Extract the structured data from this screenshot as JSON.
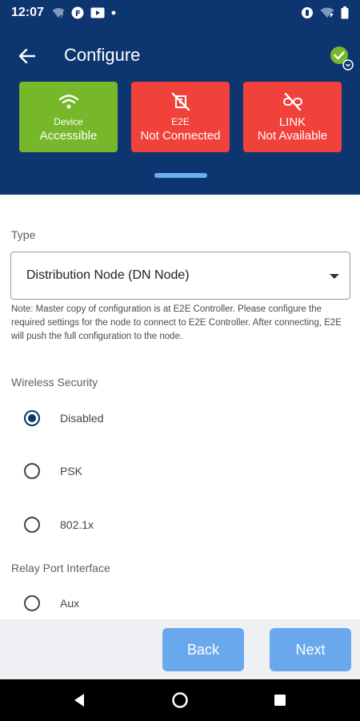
{
  "status_bar": {
    "time": "12:07",
    "left_icons": [
      "wifi-question-icon",
      "location-icon",
      "cast-icon",
      "notification-dot-icon"
    ],
    "right_icons": [
      "record-icon",
      "wifi-icon",
      "battery-icon"
    ]
  },
  "header": {
    "title": "Configure",
    "back_icon": "arrow-left-icon",
    "status_icon": "check-circle-icon"
  },
  "tiles": [
    {
      "icon": "wifi-icon",
      "line1": "Device",
      "line2": "Accessible",
      "color": "#76b82a"
    },
    {
      "icon": "cloud-off-icon",
      "line1": "E2E",
      "line2": "Not Connected",
      "color": "#f0413b"
    },
    {
      "icon": "link-off-icon",
      "line1": "LINK",
      "line2": "Not Available",
      "color": "#f0413b"
    }
  ],
  "form": {
    "type_label": "Type",
    "type_value": "Distribution Node (DN Node)",
    "note": "Note: Master copy of configuration is at E2E Controller. Please configure the required settings for the node to connect to E2E Controller. After connecting, E2E will push the full configuration to the node.",
    "wireless_label": "Wireless Security",
    "wireless_options": [
      {
        "label": "Disabled",
        "checked": true
      },
      {
        "label": "PSK",
        "checked": false
      },
      {
        "label": "802.1x",
        "checked": false
      }
    ],
    "relay_label": "Relay Port Interface",
    "relay_options": [
      {
        "label": "Aux",
        "checked": false
      }
    ]
  },
  "footer": {
    "back_label": "Back",
    "next_label": "Next",
    "button_color": "#6aa8ee"
  },
  "colors": {
    "primary": "#0d3570",
    "success": "#76b82a",
    "error": "#f0413b"
  }
}
